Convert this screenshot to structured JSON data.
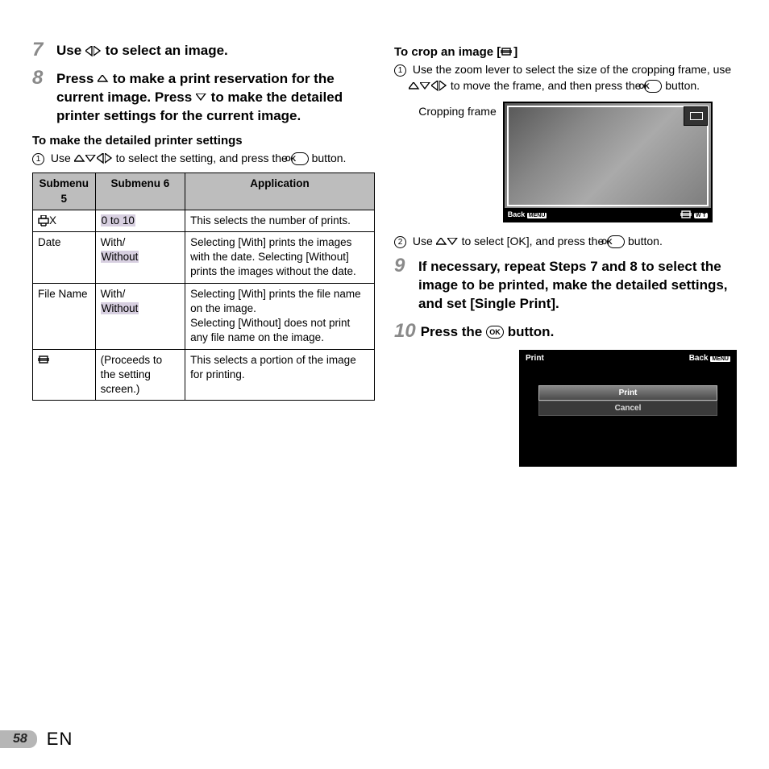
{
  "left": {
    "step7": {
      "num": "7",
      "text_before": "Use ",
      "text_after": " to select an image."
    },
    "step8": {
      "num": "8",
      "line1a": "Press ",
      "line1b": " to make a print reservation for the current image. Press ",
      "line1c": " to make the detailed printer settings for the current image."
    },
    "detailed_heading": "To make the detailed printer settings",
    "detailed_body_a": "Use ",
    "detailed_body_b": " to select the setting, and press the ",
    "detailed_body_c": " button.",
    "table": {
      "headers": [
        "Submenu 5",
        "Submenu 6",
        "Application"
      ],
      "rows": [
        {
          "c1_suffix": "X",
          "c2": "0 to 10",
          "c3": "This selects the number of prints."
        },
        {
          "c1": "Date",
          "c2a": "With/",
          "c2b": "Without",
          "c3": "Selecting [With] prints the images with the date. Selecting [Without] prints the images without the date."
        },
        {
          "c1": "File Name",
          "c2a": "With/",
          "c2b": "Without",
          "c3": "Selecting [With] prints the file name on the image.\nSelecting [Without] does not print any file name on the image."
        },
        {
          "c2": "(Proceeds to the setting screen.)",
          "c3": "This selects a portion of the image for printing."
        }
      ]
    }
  },
  "right": {
    "crop_heading_a": "To crop an image [",
    "crop_heading_b": "]",
    "crop_body1_a": "Use the zoom lever to select the size of the cropping frame, use ",
    "crop_body1_b": " to move the frame, and then press the ",
    "crop_body1_c": " button.",
    "crop_label": "Cropping frame",
    "lcd_back": "Back",
    "lcd_menu": "MENU",
    "lcd_wt": "W T",
    "crop_body2_a": "Use ",
    "crop_body2_b": " to select [OK], and press the ",
    "crop_body2_c": " button.",
    "step9": {
      "num": "9",
      "text": "If necessary, repeat Steps 7 and 8 to select the image to be printed, make the detailed settings, and set [Single Print]."
    },
    "step10": {
      "num": "10",
      "text_a": "Press the ",
      "text_b": " button."
    },
    "print_lcd": {
      "title": "Print",
      "back": "Back",
      "menu": "MENU",
      "opt1": "Print",
      "opt2": "Cancel"
    }
  },
  "footer": {
    "page": "58",
    "lang": "EN"
  },
  "ok_label": "OK"
}
